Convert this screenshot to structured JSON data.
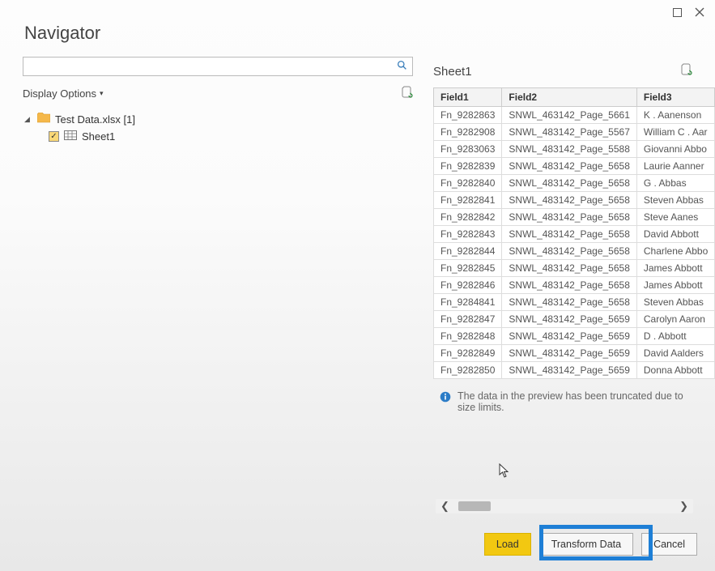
{
  "window": {
    "title": "Navigator"
  },
  "left": {
    "search_placeholder": "",
    "display_options_label": "Display Options",
    "tree": {
      "file_label": "Test Data.xlsx [1]",
      "sheet_label": "Sheet1"
    }
  },
  "right": {
    "title": "Sheet1",
    "columns": [
      "Field1",
      "Field2",
      "Field3"
    ],
    "rows": [
      {
        "f1": "Fn_9282863",
        "f2": "SNWL_463142_Page_5661",
        "f3": "K . Aanenson"
      },
      {
        "f1": "Fn_9282908",
        "f2": "SNWL_483142_Page_5567",
        "f3": "William C . Aar"
      },
      {
        "f1": "Fn_9283063",
        "f2": "SNWL_483142_Page_5588",
        "f3": "Giovanni Abbo"
      },
      {
        "f1": "Fn_9282839",
        "f2": "SNWL_483142_Page_5658",
        "f3": "Laurie Aanner"
      },
      {
        "f1": "Fn_9282840",
        "f2": "SNWL_483142_Page_5658",
        "f3": "G . Abbas"
      },
      {
        "f1": "Fn_9282841",
        "f2": "SNWL_483142_Page_5658",
        "f3": "Steven Abbas"
      },
      {
        "f1": "Fn_9282842",
        "f2": "SNWL_483142_Page_5658",
        "f3": "Steve Aanes"
      },
      {
        "f1": "Fn_9282843",
        "f2": "SNWL_483142_Page_5658",
        "f3": "David Abbott"
      },
      {
        "f1": "Fn_9282844",
        "f2": "SNWL_483142_Page_5658",
        "f3": "Charlene Abbo"
      },
      {
        "f1": "Fn_9282845",
        "f2": "SNWL_483142_Page_5658",
        "f3": "James Abbott"
      },
      {
        "f1": "Fn_9282846",
        "f2": "SNWL_483142_Page_5658",
        "f3": "James Abbott"
      },
      {
        "f1": "Fn_9284841",
        "f2": "SNWL_483142_Page_5658",
        "f3": "Steven Abbas"
      },
      {
        "f1": "Fn_9282847",
        "f2": "SNWL_483142_Page_5659",
        "f3": "Carolyn Aaron"
      },
      {
        "f1": "Fn_9282848",
        "f2": "SNWL_483142_Page_5659",
        "f3": "D . Abbott"
      },
      {
        "f1": "Fn_9282849",
        "f2": "SNWL_483142_Page_5659",
        "f3": "David Aalders"
      },
      {
        "f1": "Fn_9282850",
        "f2": "SNWL_483142_Page_5659",
        "f3": "Donna Abbott"
      }
    ],
    "info_text": "The data in the preview has been truncated due to size limits."
  },
  "buttons": {
    "load": "Load",
    "transform": "Transform Data",
    "cancel": "Cancel"
  }
}
